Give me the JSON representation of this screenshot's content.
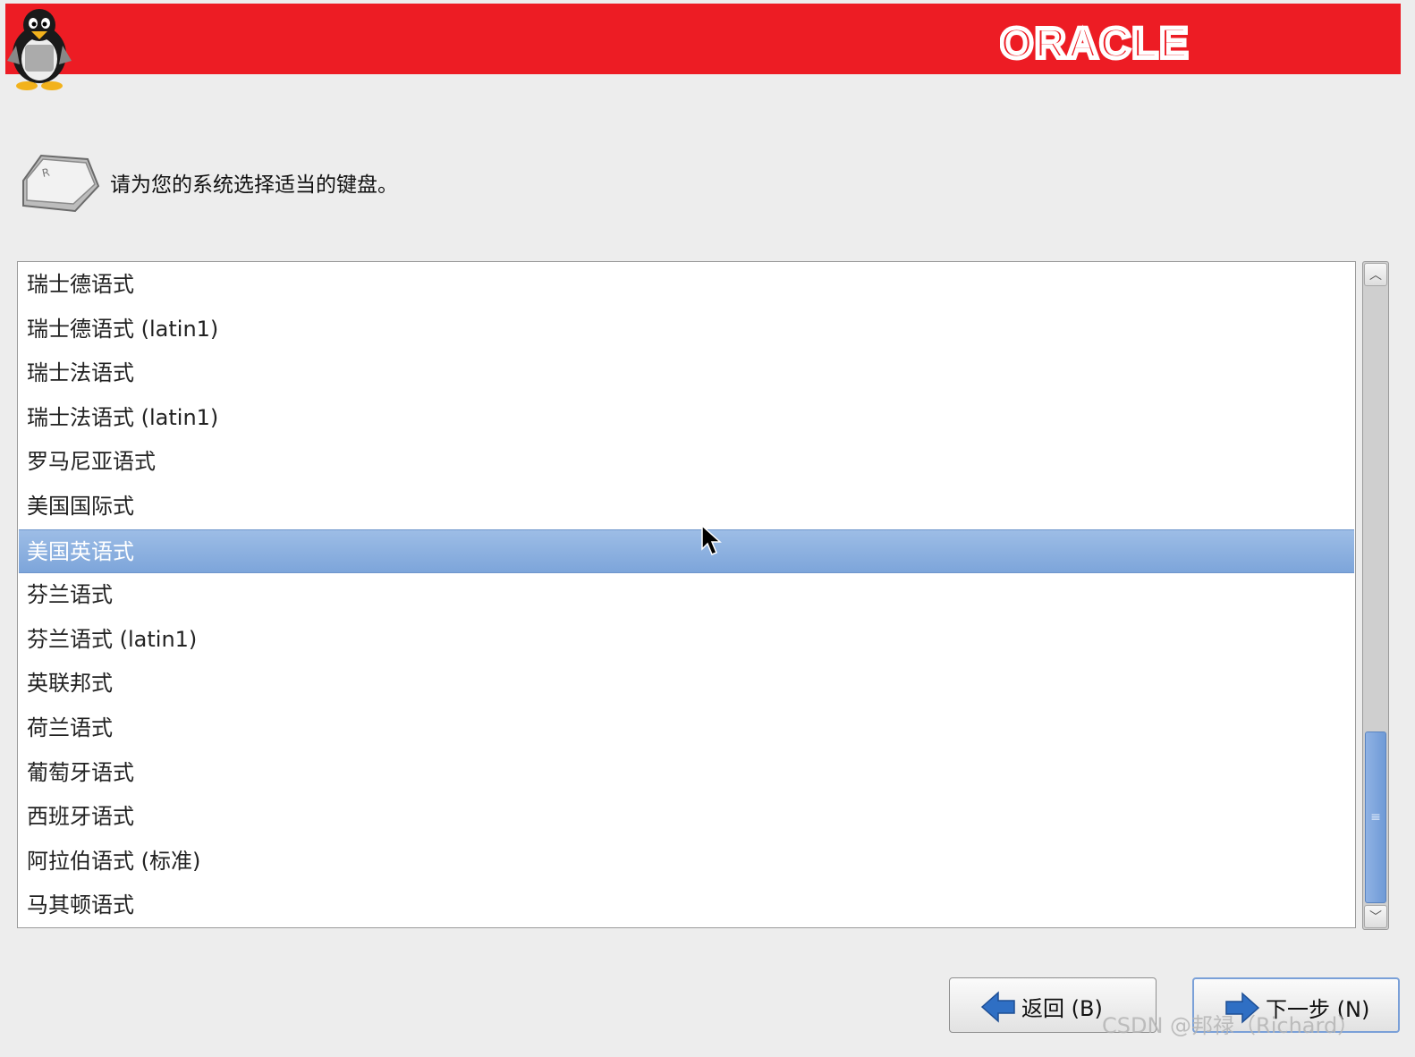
{
  "header": {
    "logo_text": "ORACLE",
    "banner_color": "#ed1c24"
  },
  "prompt": {
    "text": "请为您的系统选择适当的键盘。",
    "icon": "keyboard-key-icon"
  },
  "keyboard_list": {
    "items": [
      "瑞士德语式",
      "瑞士德语式 (latin1)",
      "瑞士法语式",
      "瑞士法语式 (latin1)",
      "罗马尼亚语式",
      "美国国际式",
      "美国英语式",
      "芬兰语式",
      "芬兰语式 (latin1)",
      "英联邦式",
      "荷兰语式",
      "葡萄牙语式",
      "西班牙语式",
      "阿拉伯语式 (标准)",
      "马其顿语式"
    ],
    "selected": "美国英语式",
    "selected_color": "#86abdd"
  },
  "buttons": {
    "back_label": "返回 (B)",
    "back_icon": "arrow-left-icon",
    "next_label": "下一步 (N)",
    "next_icon": "arrow-right-icon"
  },
  "watermark": "CSDN @邦禄（Richard）"
}
